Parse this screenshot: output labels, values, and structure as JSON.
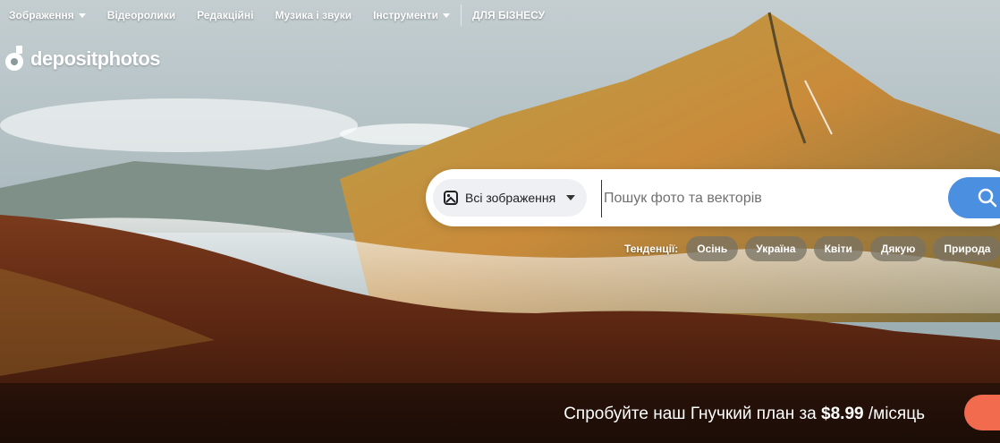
{
  "nav": {
    "items": [
      {
        "label": "Зображення",
        "has_dropdown": true
      },
      {
        "label": "Відеоролики",
        "has_dropdown": false
      },
      {
        "label": "Редакційні",
        "has_dropdown": false
      },
      {
        "label": "Музика і звуки",
        "has_dropdown": false
      },
      {
        "label": "Інструменти",
        "has_dropdown": true
      }
    ],
    "business": "ДЛЯ БІЗНЕСУ"
  },
  "logo": {
    "text": "depositphotos",
    "icon": "depositphotos-logo-icon"
  },
  "search": {
    "type_label": "Всі зображення",
    "type_icon": "image-icon",
    "placeholder": "Пошук фото та векторів",
    "value": "",
    "button_icon": "search-icon"
  },
  "trends": {
    "label": "Тенденції:",
    "chips": [
      "Осінь",
      "Україна",
      "Квіти",
      "Дякую",
      "Природа"
    ]
  },
  "promo": {
    "text_before": "Спробуйте наш Гнучкий план за ",
    "price": "$8.99",
    "text_after": " /місяць"
  },
  "colors": {
    "search_button": "#4a8fe0",
    "promo_button": "#f36b4e",
    "chip_bg": "#78735f"
  }
}
